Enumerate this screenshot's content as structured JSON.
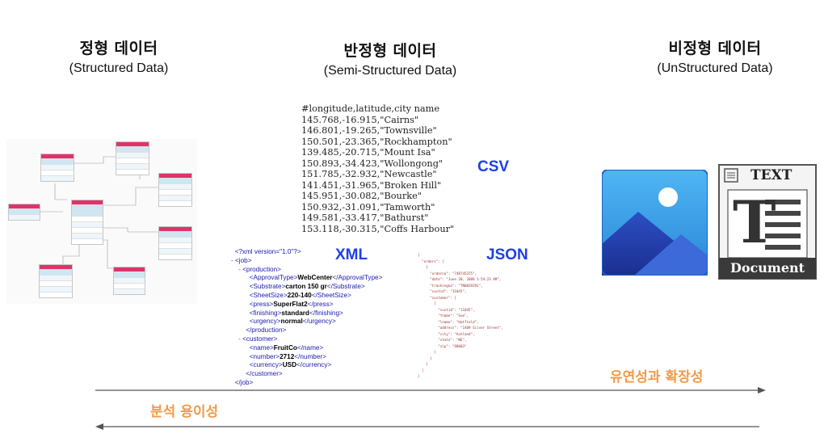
{
  "columns": {
    "structured": {
      "ko": "정형 데이터",
      "en": "(Structured Data)"
    },
    "semi": {
      "ko": "반정형 데이터",
      "en": "(Semi-Structured Data)"
    },
    "unstructured": {
      "ko": "비정형 데이터",
      "en": "(UnStructured Data)"
    }
  },
  "labels": {
    "csv": "CSV",
    "xml": "XML",
    "json": "JSON"
  },
  "csv_lines": [
    "#longitude,latitude,city name",
    "145.768,-16.915,\"Cairns\"",
    "146.801,-19.265,\"Townsville\"",
    "150.501,-23.365,\"Rockhampton\"",
    "139.485,-20.715,\"Mount Isa\"",
    "150.893,-34.423,\"Wollongong\"",
    "151.785,-32.932,\"Newcastle\"",
    "141.451,-31.965,\"Broken Hill\"",
    "145.951,-30.082,\"Bourke\"",
    "150.932,-31.091,\"Tamworth\"",
    "149.581,-33.417,\"Bathurst\"",
    "153.118,-30.315,\"Coffs Harbour\""
  ],
  "xml": {
    "decl": "<?xml version=\"1.0\"?>",
    "job_open": "<job>",
    "production_open": "<production>",
    "approval_val": "WebCenter",
    "substrate_val": "carton 150 gr",
    "sheetsize_val": "220-140",
    "press_val": "SuperFlat2",
    "finishing_val": "standard",
    "urgency_val": "normal",
    "production_close": "</production>",
    "customer_open": "<customer>",
    "name_val": "FruitCo",
    "number_val": "2712",
    "currency_val": "USD",
    "customer_close": "</customer>",
    "job_close": "</job>"
  },
  "json_lines": [
    "{",
    "  \"orders\": [",
    "    {",
    "      \"orderno\": \"748745375\",",
    "      \"date\": \"June 30, 2088 1:54:23 AM\",",
    "      \"trackingno\": \"TN0039291\",",
    "      \"custid\": \"11045\",",
    "      \"customer\": [",
    "        {",
    "          \"custid\": \"11045\",",
    "          \"fname\": \"Sue\",",
    "          \"lname\": \"Hatfield\",",
    "          \"address\": \"1409 Silver Street\",",
    "          \"city\": \"Ashland\",",
    "          \"state\": \"NE\",",
    "          \"zip\": \"68003\"",
    "        }",
    "      ]",
    "    }",
    "  ]",
    "}"
  ],
  "doc_icon": {
    "top": "TEXT",
    "letter": "T",
    "bottom": "Document"
  },
  "arrows": {
    "right_label": "유연성과 확장성",
    "left_label": "분석 용이성"
  },
  "colors": {
    "tag_blue": "#1e40e6",
    "orange": "#f29a47",
    "erd_header": "#e0336a"
  }
}
